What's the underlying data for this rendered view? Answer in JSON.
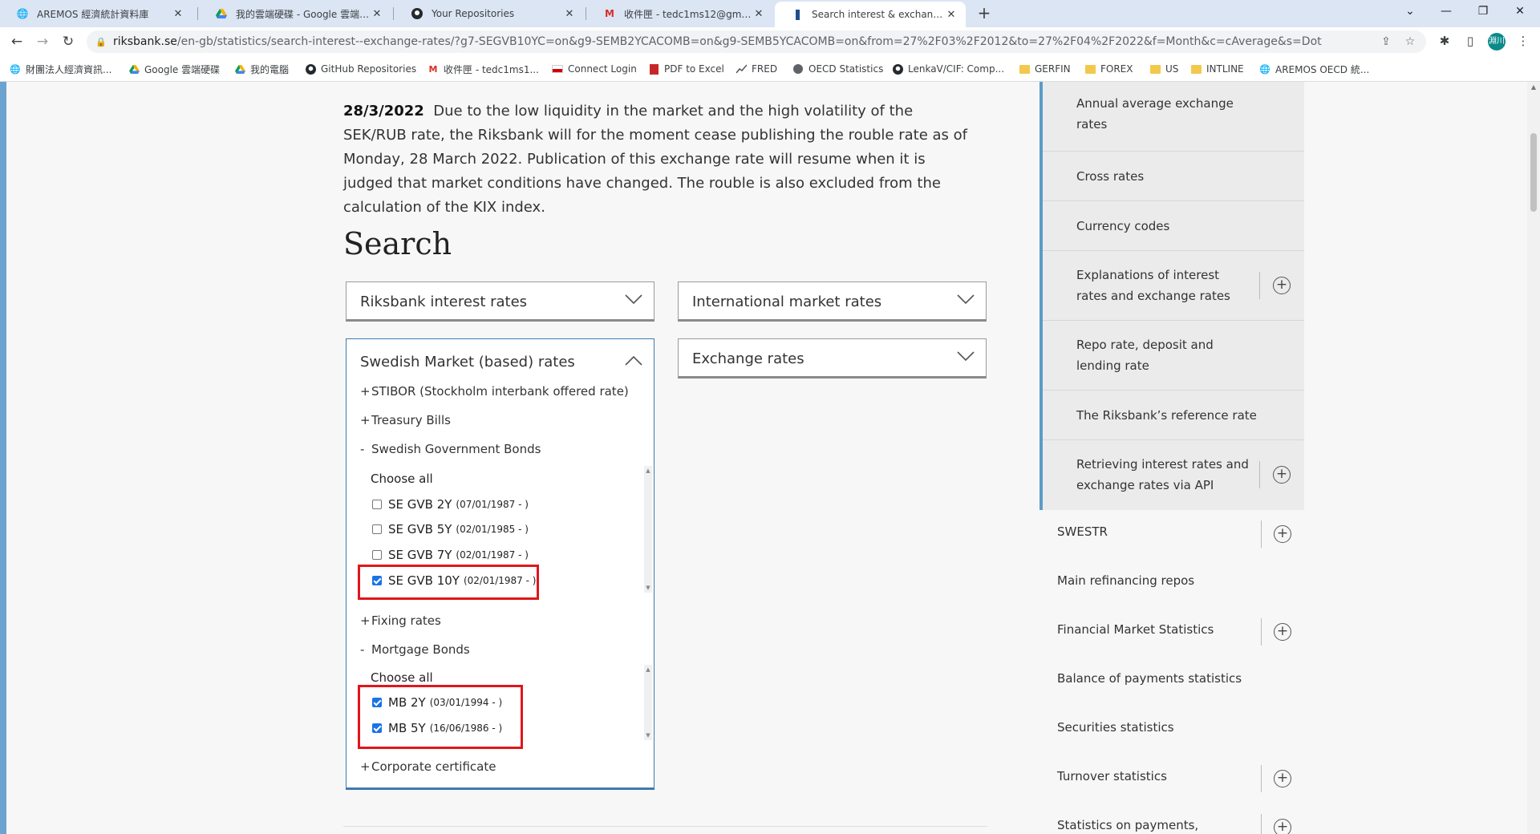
{
  "browser": {
    "tabs": [
      {
        "title": "AREMOS 經濟統計資料庫",
        "icon": "globe-icon"
      },
      {
        "title": "我的雲端硬碟 - Google 雲端硬碟",
        "icon": "google-drive-icon"
      },
      {
        "title": "Your Repositories",
        "icon": "github-icon"
      },
      {
        "title": "收件匣 - tedc1ms12@gmail.com",
        "icon": "gmail-icon"
      },
      {
        "title": "Search interest & exchange rates",
        "icon": "riksbank-icon"
      }
    ],
    "url_host": "riksbank.se",
    "url_path": "/en-gb/statistics/search-interest--exchange-rates/?g7-SEGVB10YC=on&g9-SEMB2YCACOMB=on&g9-SEMB5YCACOMB=on&from=27%2F03%2F2012&to=27%2F04%2F2022&f=Month&c=cAverage&s=Dot",
    "profile_initials": "淵川",
    "bookmarks": [
      {
        "label": "財團法人經濟資訊...",
        "icon": "globe-icon"
      },
      {
        "label": "Google 雲端硬碟",
        "icon": "google-drive-icon"
      },
      {
        "label": "我的電腦",
        "icon": "google-drive-icon"
      },
      {
        "label": "GitHub Repositories",
        "icon": "github-icon"
      },
      {
        "label": "收件匣 - tedc1ms1...",
        "icon": "gmail-icon"
      },
      {
        "label": "Connect Login",
        "icon": "flag-icon"
      },
      {
        "label": "PDF to Excel",
        "icon": "pdf-icon"
      },
      {
        "label": "FRED",
        "icon": "chart-icon"
      },
      {
        "label": "OECD Statistics",
        "icon": "oecd-icon"
      },
      {
        "label": "LenkaV/CIF: Comp...",
        "icon": "github-icon"
      },
      {
        "label": "GERFIN",
        "icon": "folder-icon"
      },
      {
        "label": "FOREX",
        "icon": "folder-icon"
      },
      {
        "label": "US",
        "icon": "folder-icon"
      },
      {
        "label": "INTLINE",
        "icon": "folder-icon"
      },
      {
        "label": "AREMOS OECD 統...",
        "icon": "globe-icon"
      }
    ]
  },
  "notice": {
    "date": "28/3/2022",
    "text": "Due to the low liquidity in the market and the high volatility of the SEK/RUB rate, the Riksbank will for the moment cease publishing the rouble rate as of Monday, 28 March 2022. Publication of this exchange rate will resume when it is judged that market conditions have changed. The rouble is also excluded from the calculation of the KIX index."
  },
  "search": {
    "title": "Search",
    "dropdowns": {
      "riksbank": "Riksbank interest rates",
      "international": "International market rates",
      "swedish": "Swedish Market (based) rates",
      "exchange": "Exchange rates"
    },
    "tree": {
      "stibor": {
        "sym": "+",
        "label": "STIBOR (Stockholm interbank offered rate)"
      },
      "treasury": {
        "sym": "+",
        "label": "Treasury Bills"
      },
      "gov_bonds": {
        "sym": "-",
        "label": "Swedish Government Bonds"
      },
      "fixing": {
        "sym": "+",
        "label": "Fixing rates"
      },
      "mortgage": {
        "sym": "-",
        "label": "Mortgage Bonds"
      },
      "corporate": {
        "sym": "+",
        "label": "Corporate certificate"
      }
    },
    "choose_all": "Choose all",
    "gov_bond_items": [
      {
        "label": "SE GVB 2Y",
        "date": "(07/01/1987 - )",
        "checked": false
      },
      {
        "label": "SE GVB 5Y",
        "date": "(02/01/1985 - )",
        "checked": false
      },
      {
        "label": "SE GVB 7Y",
        "date": "(02/01/1987 - )",
        "checked": false
      },
      {
        "label": "SE GVB 10Y",
        "date": "(02/01/1987 - )",
        "checked": true
      }
    ],
    "mortgage_items": [
      {
        "label": "MB 2Y",
        "date": "(03/01/1994 - )",
        "checked": true
      },
      {
        "label": "MB 5Y",
        "date": "(16/06/1986 - )",
        "checked": true
      }
    ]
  },
  "sidebar": {
    "sub_items": [
      {
        "label": "Annual average exchange rates",
        "has_plus": false
      },
      {
        "label": "Cross rates",
        "has_plus": false
      },
      {
        "label": "Currency codes",
        "has_plus": false
      },
      {
        "label": "Explanations of interest rates and exchange rates",
        "has_plus": true
      },
      {
        "label": "Repo rate, deposit and lending rate",
        "has_plus": false
      },
      {
        "label": "The Riksbank’s reference rate",
        "has_plus": false
      },
      {
        "label": "Retrieving interest rates and exchange rates via API",
        "has_plus": true
      }
    ],
    "items": [
      {
        "label": "SWESTR",
        "has_plus": true
      },
      {
        "label": "Main refinancing repos",
        "has_plus": false
      },
      {
        "label": "Financial Market Statistics",
        "has_plus": true
      },
      {
        "label": "Balance of payments statistics",
        "has_plus": false
      },
      {
        "label": "Securities statistics",
        "has_plus": false
      },
      {
        "label": "Turnover statistics",
        "has_plus": true
      },
      {
        "label": "Statistics on payments,",
        "has_plus": true
      }
    ]
  },
  "colors": {
    "accent": "#5a9cc7",
    "highlight": "#e0161b",
    "checkbox": "#1a73e8"
  }
}
